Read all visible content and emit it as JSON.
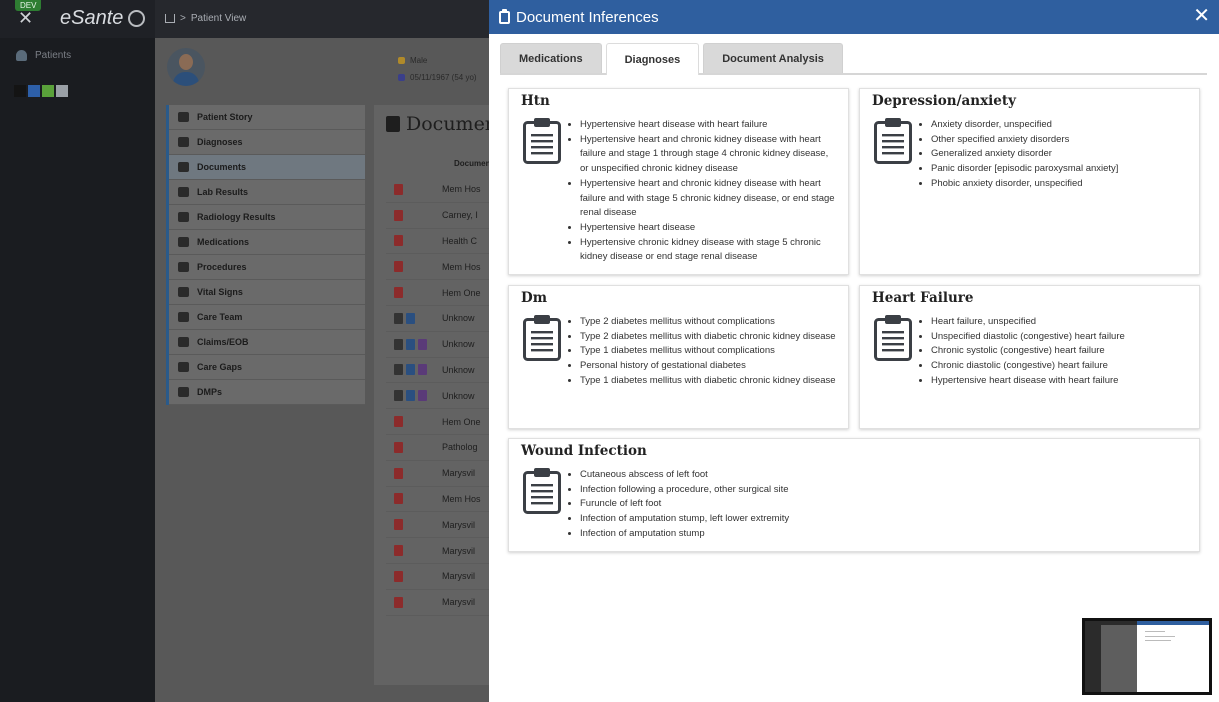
{
  "app": {
    "badge": "DEV",
    "logo": "eSante",
    "close_icon": "close-icon"
  },
  "breadcrumb": {
    "home_icon": "home-icon",
    "separator": ">",
    "current": "Patient View"
  },
  "rail": {
    "patients_label": "Patients",
    "swatch_colors": [
      "#141414",
      "#2d5fa8",
      "#5aa13a",
      "#9aa0a6"
    ]
  },
  "patient": {
    "sex": "Male",
    "dob": "05/11/1967 (54 yo)"
  },
  "menu": [
    {
      "label": "Patient Story",
      "icon": "book-icon"
    },
    {
      "label": "Diagnoses",
      "icon": "diagnoses-icon"
    },
    {
      "label": "Documents",
      "icon": "documents-icon",
      "active": true
    },
    {
      "label": "Lab Results",
      "icon": "flask-icon"
    },
    {
      "label": "Radiology Results",
      "icon": "radiology-icon"
    },
    {
      "label": "Medications",
      "icon": "pill-bottle-icon"
    },
    {
      "label": "Procedures",
      "icon": "bed-icon"
    },
    {
      "label": "Vital Signs",
      "icon": "heartbeat-icon"
    },
    {
      "label": "Care Team",
      "icon": "user-md-icon"
    },
    {
      "label": "Claims/EOB",
      "icon": "file-invoice-icon"
    },
    {
      "label": "Care Gaps",
      "icon": "star-icon"
    },
    {
      "label": "DMPs",
      "icon": "list-icon"
    }
  ],
  "documents": {
    "title": "Documents",
    "column_header": "Document",
    "rows": [
      {
        "name": "Mem Hos",
        "icons": [
          "red"
        ]
      },
      {
        "name": "Carney, I",
        "icons": [
          "red"
        ]
      },
      {
        "name": "Health C",
        "icons": [
          "red"
        ]
      },
      {
        "name": "Mem Hos",
        "icons": [
          "red"
        ]
      },
      {
        "name": "Hem One",
        "icons": [
          "red"
        ]
      },
      {
        "name": "Unknow",
        "icons": [
          "gray",
          "blue"
        ]
      },
      {
        "name": "Unknow",
        "icons": [
          "gray",
          "blue",
          "purple"
        ]
      },
      {
        "name": "Unknow",
        "icons": [
          "gray",
          "blue",
          "purple"
        ]
      },
      {
        "name": "Unknow",
        "icons": [
          "gray",
          "blue",
          "purple"
        ]
      },
      {
        "name": "Hem One",
        "icons": [
          "red"
        ]
      },
      {
        "name": "Patholog",
        "icons": [
          "red"
        ]
      },
      {
        "name": "Marysvil",
        "icons": [
          "red"
        ]
      },
      {
        "name": "Mem Hos",
        "icons": [
          "red"
        ]
      },
      {
        "name": "Marysvil",
        "icons": [
          "red"
        ]
      },
      {
        "name": "Marysvil",
        "icons": [
          "red"
        ]
      },
      {
        "name": "Marysvil",
        "icons": [
          "red"
        ]
      },
      {
        "name": "Marysvil",
        "icons": [
          "red"
        ]
      }
    ]
  },
  "modal": {
    "title": "Document Inferences",
    "tabs": [
      {
        "label": "Medications",
        "active": false
      },
      {
        "label": "Diagnoses",
        "active": true
      },
      {
        "label": "Document Analysis",
        "active": false
      }
    ],
    "cards": [
      {
        "title": "Htn",
        "items": [
          "Hypertensive heart disease with heart failure",
          "Hypertensive heart and chronic kidney disease with heart failure and stage 1 through stage 4 chronic kidney disease, or unspecified chronic kidney disease",
          "Hypertensive heart and chronic kidney disease with heart failure and with stage 5 chronic kidney disease, or end stage renal disease",
          "Hypertensive heart disease",
          "Hypertensive chronic kidney disease with stage 5 chronic kidney disease or end stage renal disease"
        ]
      },
      {
        "title": "Depression/anxiety",
        "items": [
          "Anxiety disorder, unspecified",
          "Other specified anxiety disorders",
          "Generalized anxiety disorder",
          "Panic disorder [episodic paroxysmal anxiety]",
          "Phobic anxiety disorder, unspecified"
        ]
      },
      {
        "title": "Dm",
        "items": [
          "Type 2 diabetes mellitus without complications",
          "Type 2 diabetes mellitus with diabetic chronic kidney disease",
          "Type 1 diabetes mellitus without complications",
          "Personal history of gestational diabetes",
          "Type 1 diabetes mellitus with diabetic chronic kidney disease"
        ]
      },
      {
        "title": "Heart Failure",
        "items": [
          "Heart failure, unspecified",
          "Unspecified diastolic (congestive) heart failure",
          "Chronic systolic (congestive) heart failure",
          "Chronic diastolic (congestive) heart failure",
          "Hypertensive heart disease with heart failure"
        ]
      },
      {
        "title": "Wound Infection",
        "items": [
          "Cutaneous abscess of left foot",
          "Infection following a procedure, other surgical site",
          "Furuncle of left foot",
          "Infection of amputation stump, left lower extremity",
          "Infection of amputation stump"
        ]
      }
    ]
  },
  "colors": {
    "header_blue": "#2f5f9f",
    "active_menu": "#6f7880"
  }
}
